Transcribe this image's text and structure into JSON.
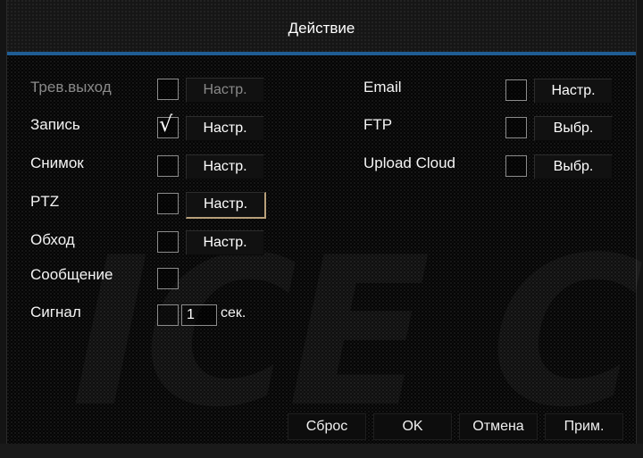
{
  "window": {
    "title": "Действие"
  },
  "watermark": {
    "text": "ICE C"
  },
  "left_rows": [
    {
      "label": "Трев.выход",
      "checked": false,
      "button": "Настр."
    },
    {
      "label": "Запись",
      "checked": true,
      "button": "Настр."
    },
    {
      "label": "Снимок",
      "checked": false,
      "button": "Настр."
    },
    {
      "label": "PTZ",
      "checked": false,
      "button": "Настр."
    },
    {
      "label": "Обход",
      "checked": false,
      "button": "Настр."
    },
    {
      "label": "Сообщение",
      "checked": false
    },
    {
      "label": "Сигнал",
      "checked": false,
      "value": "1",
      "unit": "сек."
    }
  ],
  "right_rows": [
    {
      "label": "Email",
      "checked": false,
      "button": "Настр."
    },
    {
      "label": "FTP",
      "checked": false,
      "button": "Выбр."
    },
    {
      "label": "Upload Cloud",
      "checked": false,
      "button": "Выбр."
    }
  ],
  "check_glyph": "√",
  "footer": {
    "reset": "Сброс",
    "ok": "OK",
    "cancel": "Отмена",
    "apply": "Прим."
  },
  "colors": {
    "accent_line": "#1f5d94",
    "focus_edge": "#b8a07a",
    "disabled_text": "#8a8a8a"
  }
}
